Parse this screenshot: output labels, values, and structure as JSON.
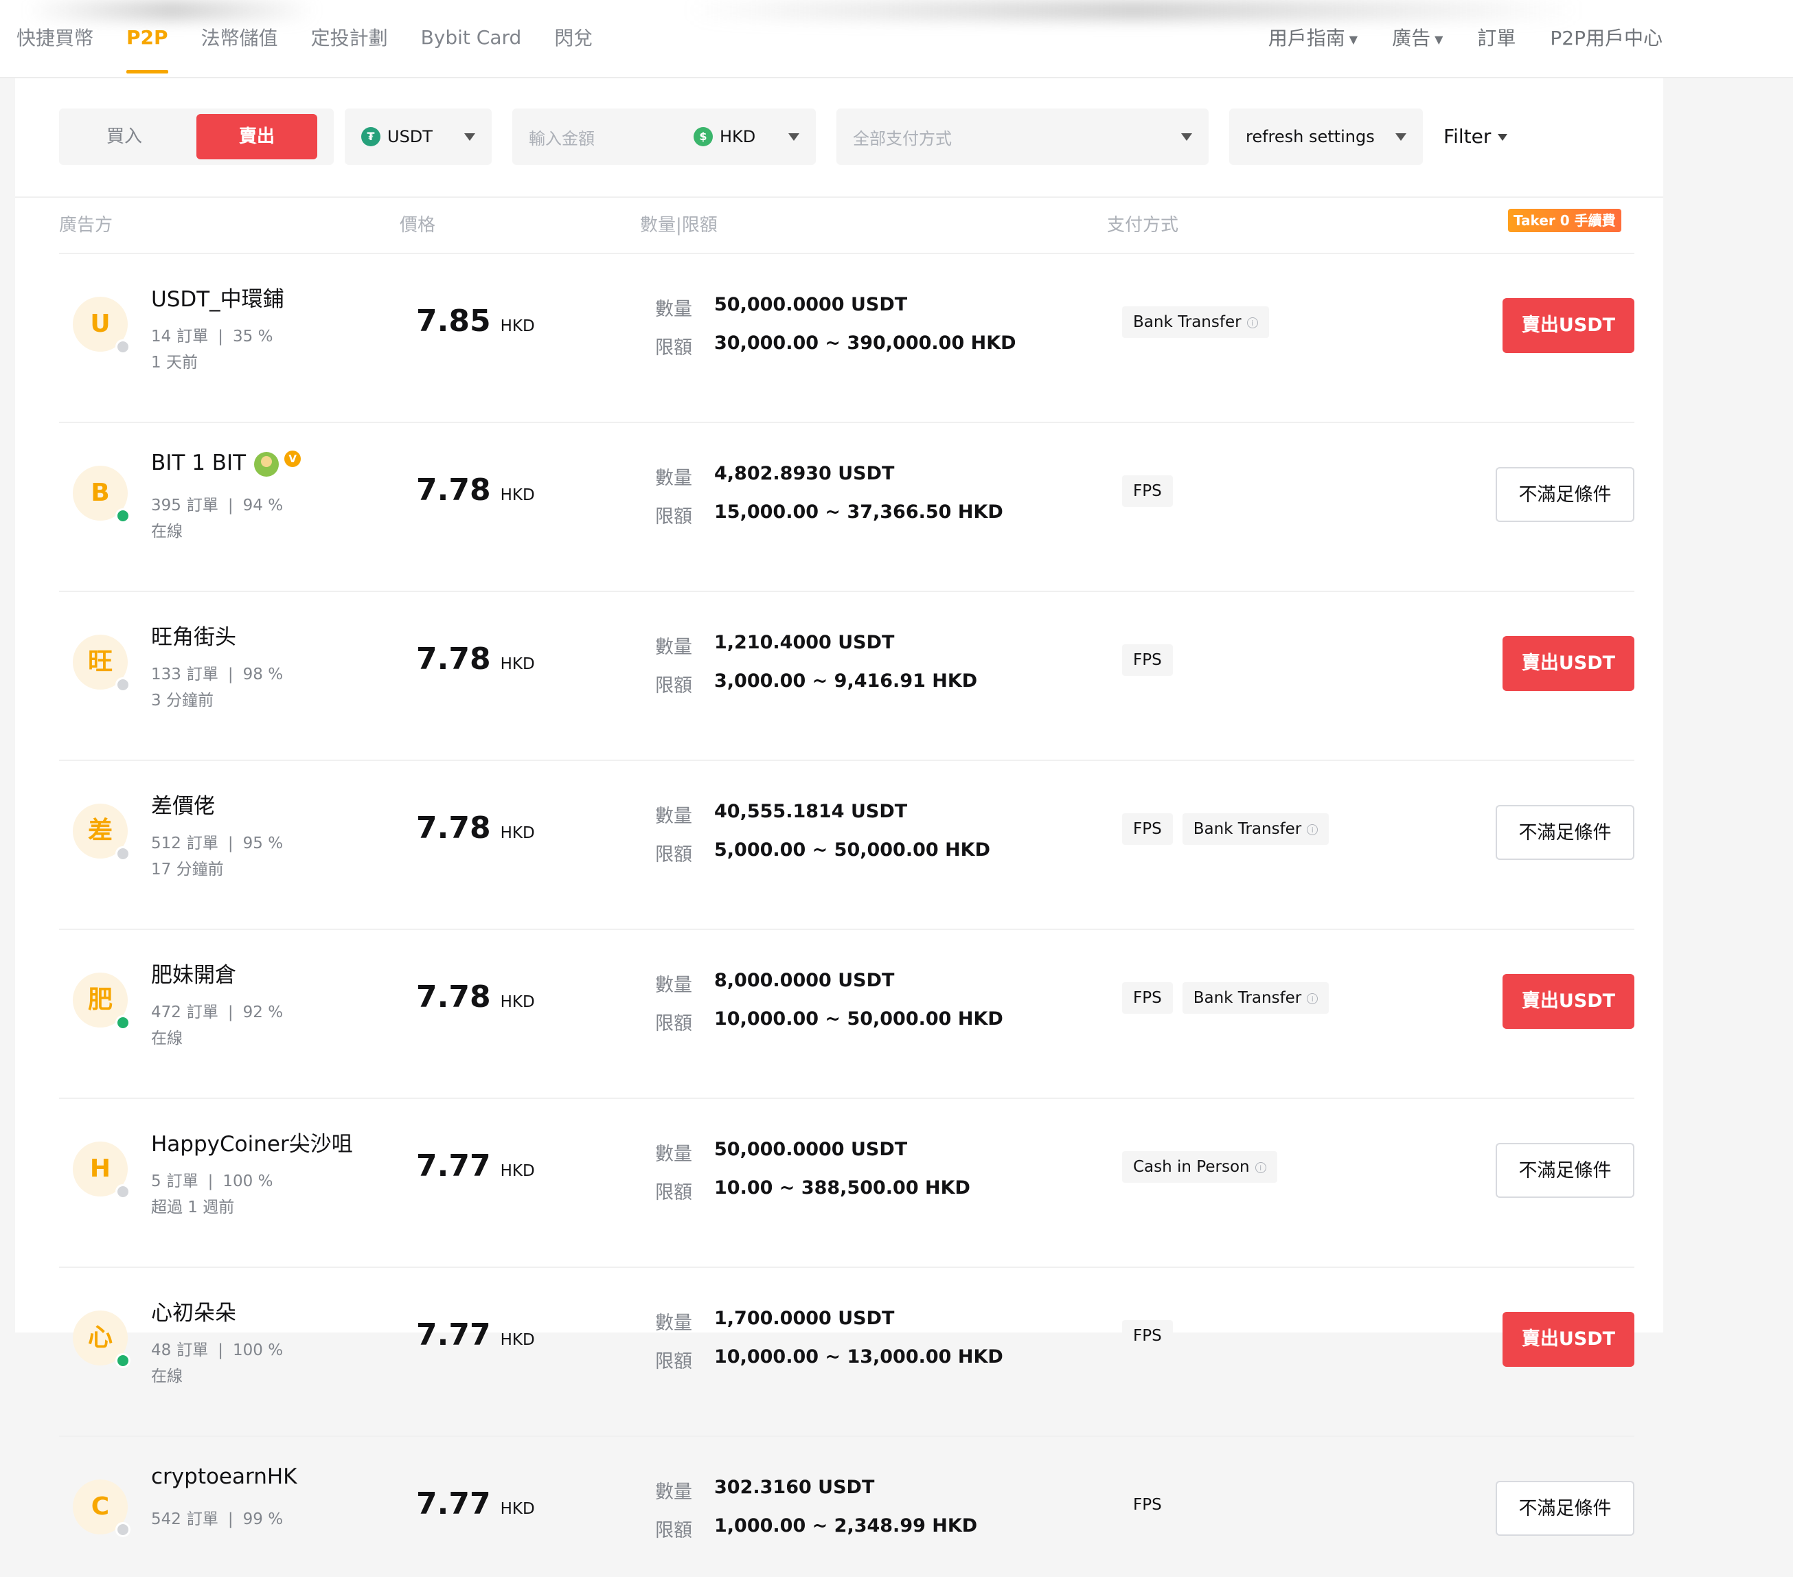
{
  "nav": {
    "left": [
      "快捷買幣",
      "P2P",
      "法幣儲值",
      "定投計劃",
      "Bybit Card",
      "閃兌"
    ],
    "right": [
      {
        "label": "用戶指南",
        "caret": true
      },
      {
        "label": "廣告",
        "caret": true
      },
      {
        "label": "訂單",
        "caret": false
      },
      {
        "label": "P2P用戶中心",
        "caret": false
      }
    ]
  },
  "filters": {
    "buy_label": "買入",
    "sell_label": "賣出",
    "coin": "USDT",
    "amount_placeholder": "輸入金額",
    "fiat": "HKD",
    "payment_placeholder": "全部支付方式",
    "refresh": "refresh settings",
    "filter": "Filter"
  },
  "table": {
    "headers": {
      "advertiser": "廣告方",
      "price": "價格",
      "quantity": "數量|限額",
      "payment": "支付方式"
    },
    "taker_badge": "Taker 0 手續費",
    "qty_label": "數量",
    "limit_label": "限額",
    "currency": "HKD",
    "orders_unit": "訂單",
    "rows": [
      {
        "initial": "U",
        "name": "USDT_中環鋪",
        "orders": "14",
        "rate": "35 %",
        "seen": "1 天前",
        "online": false,
        "price": "7.85",
        "qty": "50,000.0000 USDT",
        "limit": "30,000.00 ~ 390,000.00 HKD",
        "payments": [
          {
            "name": "Bank Transfer",
            "info": true
          }
        ],
        "action": "賣出USDT",
        "available": true
      },
      {
        "initial": "B",
        "name": "BIT 1 BIT",
        "orders": "395",
        "rate": "94 %",
        "seen": "在線",
        "online": true,
        "price": "7.78",
        "qty": "4,802.8930 USDT",
        "limit": "15,000.00 ~ 37,366.50 HKD",
        "payments": [
          {
            "name": "FPS",
            "info": false
          }
        ],
        "action": "不滿足條件",
        "available": false,
        "badges": true
      },
      {
        "initial": "旺",
        "name": "旺角街头",
        "orders": "133",
        "rate": "98 %",
        "seen": "3 分鐘前",
        "online": false,
        "price": "7.78",
        "qty": "1,210.4000 USDT",
        "limit": "3,000.00 ~ 9,416.91 HKD",
        "payments": [
          {
            "name": "FPS",
            "info": false
          }
        ],
        "action": "賣出USDT",
        "available": true
      },
      {
        "initial": "差",
        "name": "差價佬",
        "orders": "512",
        "rate": "95 %",
        "seen": "17 分鐘前",
        "online": false,
        "price": "7.78",
        "qty": "40,555.1814 USDT",
        "limit": "5,000.00 ~ 50,000.00 HKD",
        "payments": [
          {
            "name": "FPS",
            "info": false
          },
          {
            "name": "Bank Transfer",
            "info": true
          }
        ],
        "action": "不滿足條件",
        "available": false
      },
      {
        "initial": "肥",
        "name": "肥妹開倉",
        "orders": "472",
        "rate": "92 %",
        "seen": "在線",
        "online": true,
        "price": "7.78",
        "qty": "8,000.0000 USDT",
        "limit": "10,000.00 ~ 50,000.00 HKD",
        "payments": [
          {
            "name": "FPS",
            "info": false
          },
          {
            "name": "Bank Transfer",
            "info": true
          }
        ],
        "action": "賣出USDT",
        "available": true
      },
      {
        "initial": "H",
        "name": "HappyCoiner尖沙咀",
        "orders": "5",
        "rate": "100 %",
        "seen": "超過 1 週前",
        "online": false,
        "price": "7.77",
        "qty": "50,000.0000 USDT",
        "limit": "10.00 ~ 388,500.00 HKD",
        "payments": [
          {
            "name": "Cash in Person",
            "info": true
          }
        ],
        "action": "不滿足條件",
        "available": false
      },
      {
        "initial": "心",
        "name": "心初朵朵",
        "orders": "48",
        "rate": "100 %",
        "seen": "在線",
        "online": true,
        "price": "7.77",
        "qty": "1,700.0000 USDT",
        "limit": "10,000.00 ~ 13,000.00 HKD",
        "payments": [
          {
            "name": "FPS",
            "info": false
          }
        ],
        "action": "賣出USDT",
        "available": true
      },
      {
        "initial": "C",
        "name": "cryptoearnHK",
        "orders": "542",
        "rate": "99 %",
        "seen": "",
        "online": false,
        "price": "7.77",
        "qty": "302.3160 USDT",
        "limit": "1,000.00 ~ 2,348.99 HKD",
        "payments": [
          {
            "name": "FPS",
            "info": false
          }
        ],
        "action": "不滿足條件",
        "available": false
      }
    ]
  },
  "colors": {
    "accent": "#f7a600",
    "sell": "#ef454a",
    "online": "#20b26c"
  }
}
